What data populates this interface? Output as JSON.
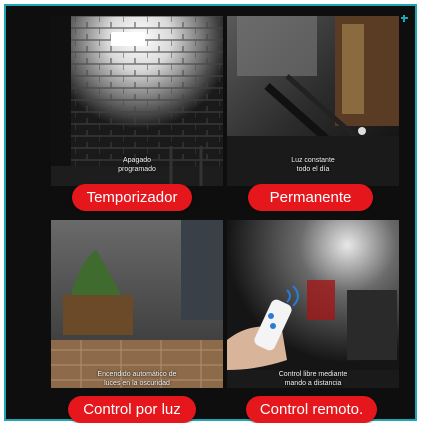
{
  "colors": {
    "frame": "#1fa6b3",
    "background": "#0e0e0e",
    "button": "#e5161c",
    "button_text": "#ffffff"
  },
  "panels": [
    {
      "id": "timer",
      "caption": [
        "Apagado",
        "programado"
      ],
      "button": "Temporizador"
    },
    {
      "id": "permanent",
      "caption": [
        "Luz constante",
        "todo el día"
      ],
      "button": "Permanente"
    },
    {
      "id": "light-control",
      "caption": [
        "Encendido automático de",
        "luces en la oscuridad"
      ],
      "button": "Control por luz"
    },
    {
      "id": "remote-control",
      "caption": [
        "Control libre mediante",
        "mando a distancia"
      ],
      "button": "Control remoto."
    }
  ]
}
